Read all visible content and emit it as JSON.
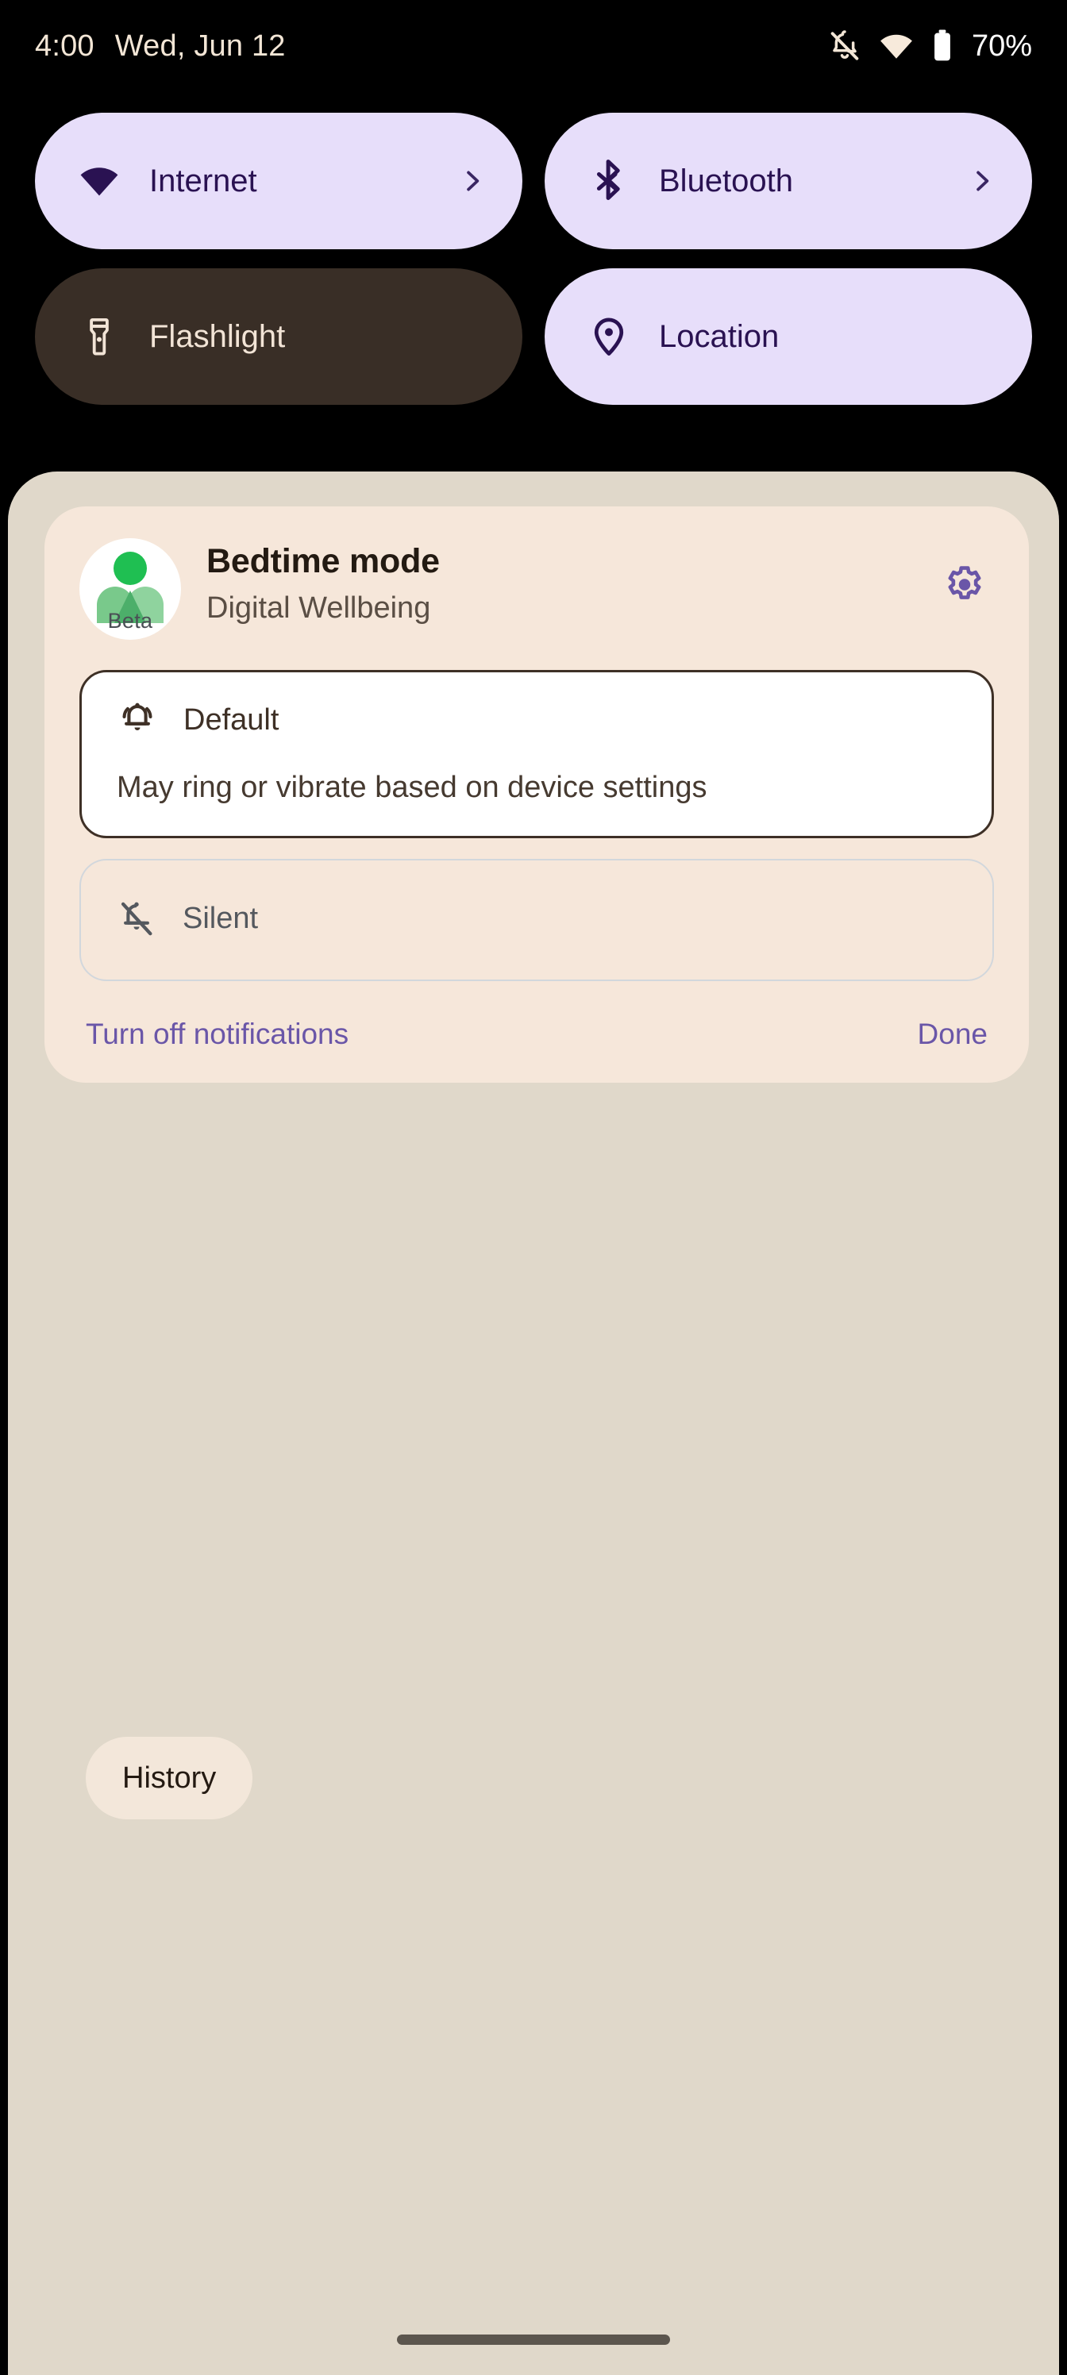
{
  "status_bar": {
    "time": "4:00",
    "date": "Wed, Jun 12",
    "battery_percent": "70%",
    "icons": {
      "notifications_silenced": "bell-muted-icon",
      "wifi": "wifi-icon",
      "battery": "battery-icon"
    },
    "colors": {
      "text": "#F3E6D6",
      "battery_text": "#FFFFFF",
      "background": "#000000"
    }
  },
  "quick_settings": {
    "tiles": [
      {
        "label": "Internet",
        "icon": "wifi-icon",
        "state": "on",
        "has_chevron": true
      },
      {
        "label": "Bluetooth",
        "icon": "bluetooth-icon",
        "state": "on",
        "has_chevron": true
      },
      {
        "label": "Flashlight",
        "icon": "flashlight-icon",
        "state": "off",
        "has_chevron": false
      },
      {
        "label": "Location",
        "icon": "location-pin-icon",
        "state": "on",
        "has_chevron": false
      }
    ],
    "colors": {
      "tile_on_bg": "#E7DEFA",
      "tile_on_fg": "#2A1252",
      "tile_off_bg": "#392E26",
      "tile_off_fg": "#F2E4D6"
    }
  },
  "shade": {
    "background": "#E0D8CA"
  },
  "notification": {
    "app_icon": {
      "name": "digital-wellbeing-icon",
      "badge_text": "Beta",
      "head_color": "#1FBF52",
      "body_color": "#79C98B"
    },
    "title": "Bedtime mode",
    "subtitle": "Digital Wellbeing",
    "settings_icon": "gear-icon",
    "settings_icon_color": "#6A56A8",
    "card_background": "#F6E7DA",
    "options": [
      {
        "label": "Default",
        "description": "May ring or vibrate based on device settings",
        "icon": "bell-ringing-icon",
        "selected": true
      },
      {
        "label": "Silent",
        "description": "",
        "icon": "bell-off-icon",
        "selected": false
      }
    ],
    "actions": {
      "turn_off_label": "Turn off notifications",
      "done_label": "Done",
      "link_color": "#6A56A8"
    }
  },
  "history": {
    "label": "History",
    "background": "#F3E7DA"
  },
  "navigation": {
    "gesture_bar": "home-gesture-bar",
    "color": "#5C564E"
  }
}
